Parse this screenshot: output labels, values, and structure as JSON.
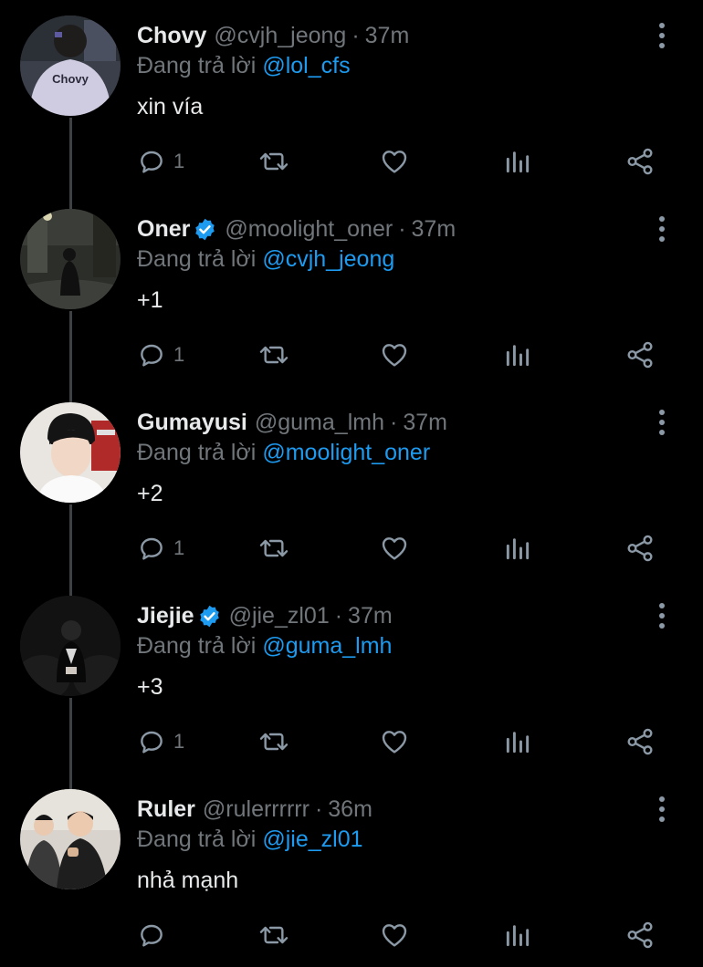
{
  "reply_prefix": "Đang trả lời",
  "colors": {
    "background": "#000000",
    "text": "#e7e9ea",
    "secondary": "#71767b",
    "link": "#1d9bf0",
    "thread_line": "#3e4144"
  },
  "tweets": [
    {
      "name": "Chovy",
      "handle": "@cvjh_jeong",
      "time": "37m",
      "reply_to": "@lol_cfs",
      "text": "xin vía",
      "reply_count": "1",
      "verified": false,
      "avatar_icon": "avatar-photo"
    },
    {
      "name": "Oner",
      "handle": "@moolight_oner",
      "time": "37m",
      "reply_to": "@cvjh_jeong",
      "text": "+1",
      "reply_count": "1",
      "verified": true,
      "avatar_icon": "avatar-photo"
    },
    {
      "name": "Gumayusi",
      "handle": "@guma_lmh",
      "time": "37m",
      "reply_to": "@moolight_oner",
      "text": "+2",
      "reply_count": "1",
      "verified": false,
      "avatar_icon": "avatar-photo"
    },
    {
      "name": "Jiejie",
      "handle": "@jie_zl01",
      "time": "37m",
      "reply_to": "@guma_lmh",
      "text": "+3",
      "reply_count": "1",
      "verified": true,
      "avatar_icon": "avatar-photo"
    },
    {
      "name": "Ruler",
      "handle": "@rulerrrrrr",
      "time": "36m",
      "reply_to": "@jie_zl01",
      "text": "nhả mạnh",
      "reply_count": "",
      "verified": false,
      "avatar_icon": "avatar-photo"
    }
  ],
  "icons": {
    "reply": "reply-icon",
    "retweet": "retweet-icon",
    "like": "heart-icon",
    "views": "views-icon",
    "share": "share-icon",
    "more": "more-options-icon",
    "verified": "verified-badge-icon"
  }
}
